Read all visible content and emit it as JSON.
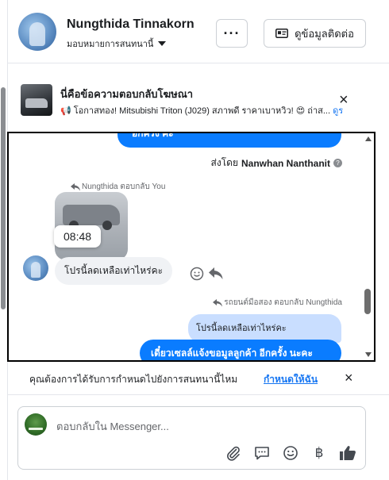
{
  "header": {
    "contact_name": "Nungthida Tinnakorn",
    "assign_label": "มอบหมายการสนทนานี้",
    "more_label": "···",
    "contact_info_label": "ดูข้อมูลติดต่อ"
  },
  "ad_reply": {
    "title": "นี่คือข้อความตอบกลับโฆษณา",
    "subtitle": "📢 โอกาสทอง! Mitsubishi Triton (J029) สภาพดี ราคาเบาหวิว! 😍 ถ่าส...",
    "link": "ดูร",
    "close_icon": "×"
  },
  "chat": {
    "top_bubble_text": "อีกครั้ง ค่ะ",
    "sent_by_prefix": "ส่งโดย",
    "sent_by_name": "Nanwhan Nanthanit",
    "reply_note_left": "Nungthida ตอบกลับ You",
    "image_time": "08:48",
    "incoming_message": "โปรนี้ลดเหลือเท่าไหร่คะ",
    "reply_note_right": "รถยนต์มือสอง ตอบกลับ Nungthida",
    "quoted_text": "โปรนี้ลดเหลือเท่าไหร่คะ",
    "outgoing_message": "เดี๋ยวเซลล์แจ้งขอมูลลูกค้า  อีกครั้ง นะคะ"
  },
  "assign_suggestion": {
    "question": "คุณต้องการได้รับการกำหนดไปยังการสนทนานี้ไหม",
    "action": "กำหนดให้ฉัน",
    "close_icon": "×"
  },
  "composer": {
    "placeholder": "ตอบกลับใน Messenger...",
    "currency_symbol": "฿"
  },
  "colors": {
    "accent": "#0a7cff",
    "link": "#1877f2",
    "quoted_bg": "#c9deff",
    "incoming_bg": "#f0f2f5"
  }
}
